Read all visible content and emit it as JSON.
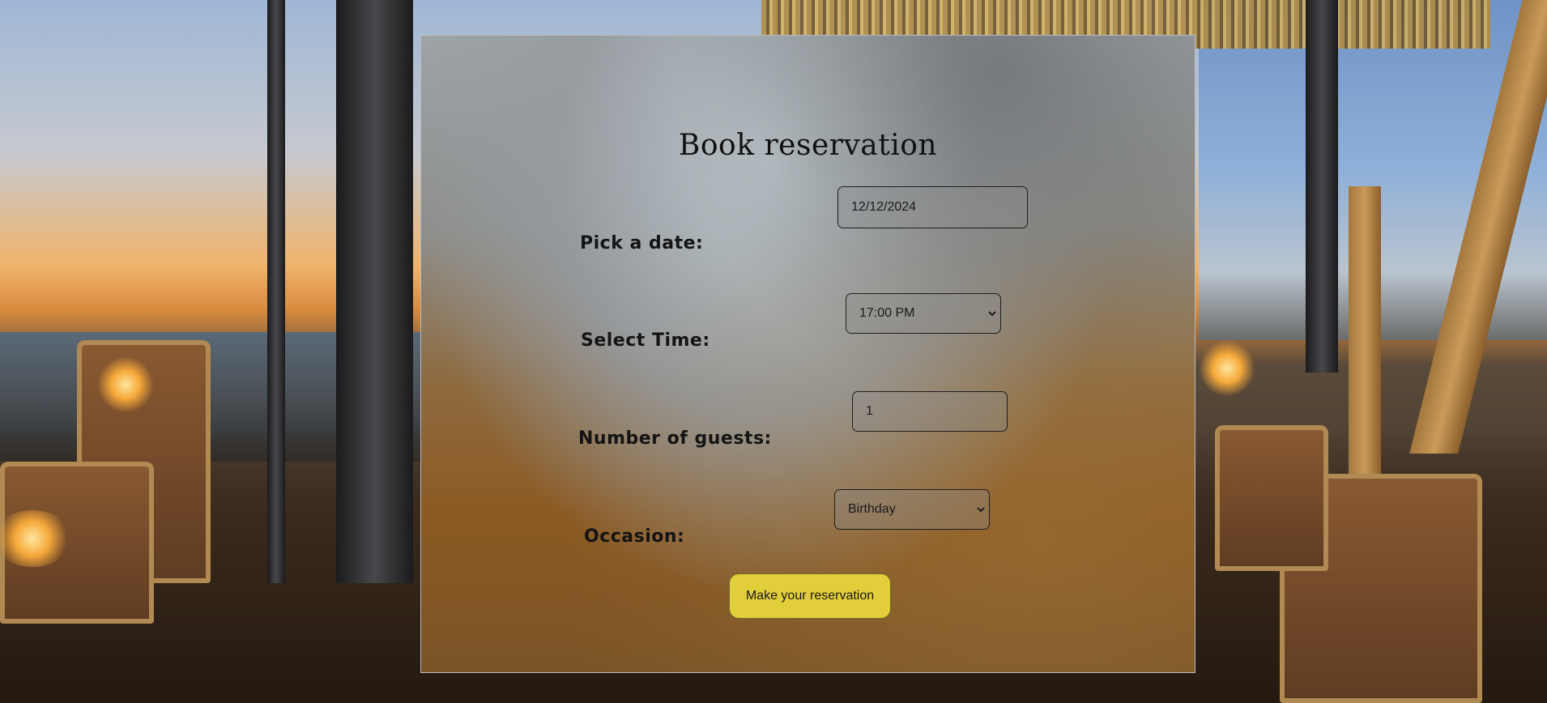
{
  "form": {
    "title": "Book reservation",
    "date": {
      "label": "Pick a date:",
      "value": "12/12/2024"
    },
    "time": {
      "label": "Select Time:",
      "selected": "17:00 PM",
      "icon": "chevron-down-icon"
    },
    "guests": {
      "label": "Number of guests:",
      "value": "1"
    },
    "occasion": {
      "label": "Occasion:",
      "selected": "Birthday",
      "icon": "chevron-down-icon"
    },
    "submit_label": "Make your reservation"
  },
  "colors": {
    "button": "#e2cd3a",
    "text": "#141414"
  }
}
